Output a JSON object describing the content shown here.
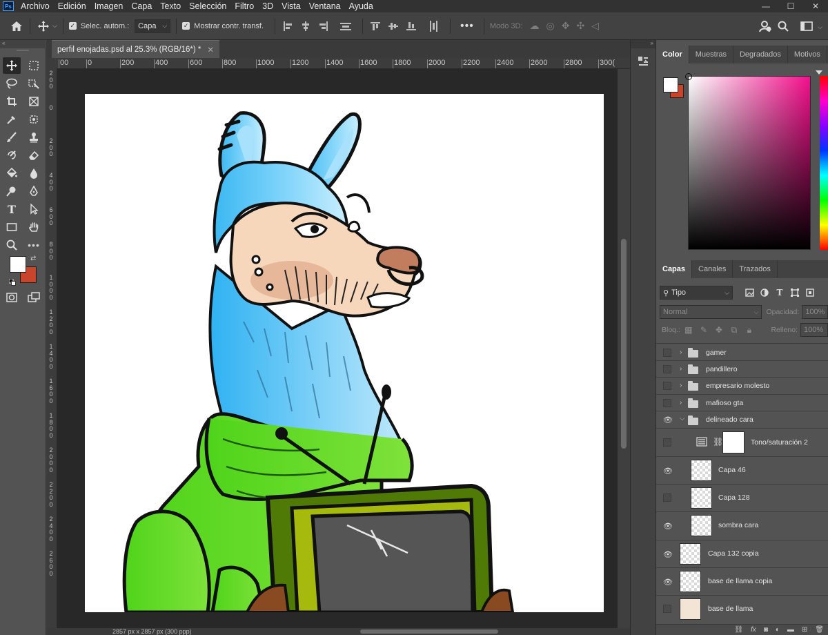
{
  "menubar": {
    "app_icon": "Ps",
    "items": [
      "Archivo",
      "Edición",
      "Imagen",
      "Capa",
      "Texto",
      "Selección",
      "Filtro",
      "3D",
      "Vista",
      "Ventana",
      "Ayuda"
    ]
  },
  "options": {
    "auto_select_label": "Selec. autom.:",
    "auto_select_target": "Capa",
    "show_transform_label": "Mostrar contr. transf.",
    "mode3d_label": "Modo 3D:"
  },
  "document": {
    "tab_title": "perfil enojadas.psd al 25.3% (RGB/16*) *",
    "status_text": "2857 px x 2857 px (300 ppp)"
  },
  "ruler": {
    "h_labels": [
      "00",
      "0",
      "200",
      "400",
      "600",
      "800",
      "1000",
      "1200",
      "1400",
      "1600",
      "1800",
      "2000",
      "2200",
      "2400",
      "2600",
      "2800",
      "300("
    ],
    "v_labels": [
      "2\n0\n0",
      "0",
      "2\n0\n0",
      "4\n0\n0",
      "6\n0\n0",
      "8\n0\n0",
      "1\n0\n0\n0",
      "1\n2\n0\n0",
      "1\n4\n0\n0",
      "1\n6\n0\n0",
      "1\n8\n0\n0",
      "2\n0\n0\n0",
      "2\n2\n0\n0",
      "2\n4\n0\n0",
      "2\n6\n0\n0"
    ]
  },
  "color_panel": {
    "tabs": [
      "Color",
      "Muestras",
      "Degradados",
      "Motivos"
    ],
    "foreground": "#ffffff",
    "background": "#c8452c"
  },
  "layers_panel": {
    "tabs": [
      "Capas",
      "Canales",
      "Trazados"
    ],
    "filter_kind": "Tipo",
    "blend_mode": "Normal",
    "opacity_label": "Opacidad:",
    "opacity_value": "100%",
    "lock_label": "Bloq.:",
    "fill_label": "Relleno:",
    "fill_value": "100%",
    "layers": [
      {
        "name": "gamer",
        "type": "group",
        "visible": false,
        "expanded": false
      },
      {
        "name": "pandillero",
        "type": "group",
        "visible": false,
        "expanded": false
      },
      {
        "name": "empresario molesto",
        "type": "group",
        "visible": false,
        "expanded": false
      },
      {
        "name": "mafioso gta",
        "type": "group",
        "visible": false,
        "expanded": false
      },
      {
        "name": "delineado cara",
        "type": "group",
        "visible": true,
        "expanded": true
      },
      {
        "name": "Tono/saturación 2",
        "type": "adjustment",
        "visible": false
      },
      {
        "name": "Capa 46",
        "type": "pixel",
        "visible": true
      },
      {
        "name": "Capa 128",
        "type": "pixel",
        "visible": false
      },
      {
        "name": "sombra cara",
        "type": "pixel",
        "visible": true
      },
      {
        "name": "Capa 132 copia",
        "type": "pixel",
        "visible": true
      },
      {
        "name": "base de llama copia",
        "type": "pixel",
        "visible": true
      },
      {
        "name": "base de llama",
        "type": "pixel",
        "visible": false
      }
    ]
  },
  "icons": {
    "home": "home-icon",
    "move": "move-icon",
    "search": "search-icon",
    "workspace": "workspace-icon"
  }
}
